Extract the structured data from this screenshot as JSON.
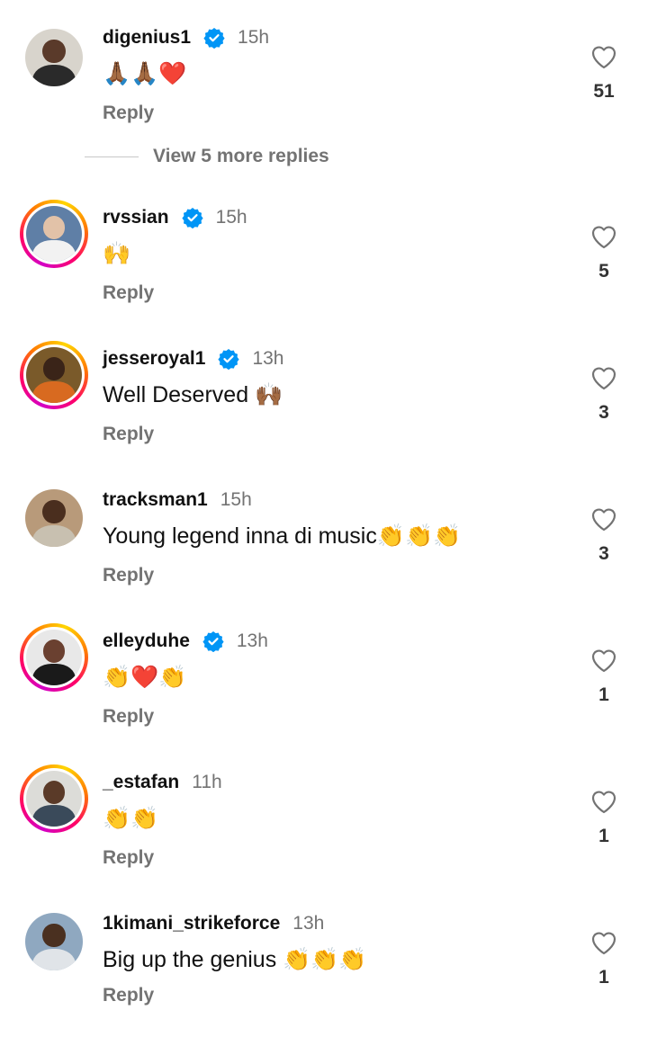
{
  "comments": [
    {
      "username": "digenius1",
      "verified": true,
      "time": "15h",
      "text": "🙏🏾🙏🏾❤️",
      "reply_label": "Reply",
      "likes": "51"
    },
    {
      "username": "rvssian",
      "verified": true,
      "time": "15h",
      "text": "🙌",
      "reply_label": "Reply",
      "likes": "5"
    },
    {
      "username": "jesseroyal1",
      "verified": true,
      "time": "13h",
      "text": "Well Deserved 🙌🏾",
      "reply_label": "Reply",
      "likes": "3"
    },
    {
      "username": "tracksman1",
      "verified": false,
      "time": "15h",
      "text": "Young legend inna di music👏👏👏",
      "reply_label": "Reply",
      "likes": "3"
    },
    {
      "username": "elleyduhe",
      "verified": true,
      "time": "13h",
      "text": "👏❤️👏",
      "reply_label": "Reply",
      "likes": "1"
    },
    {
      "username": "_estafan",
      "verified": false,
      "time": "11h",
      "text": "👏👏",
      "reply_label": "Reply",
      "likes": "1"
    },
    {
      "username": "1kimani_strikeforce",
      "verified": false,
      "time": "13h",
      "text": "Big up the genius 👏👏👏",
      "reply_label": "Reply",
      "likes": "1"
    }
  ],
  "view_more_replies": "View 5 more replies",
  "colors": {
    "verified_blue": "#0095f6",
    "muted_text": "#737373"
  },
  "icons": {
    "like": "heart-outline-icon",
    "verified": "verified-badge-icon"
  }
}
